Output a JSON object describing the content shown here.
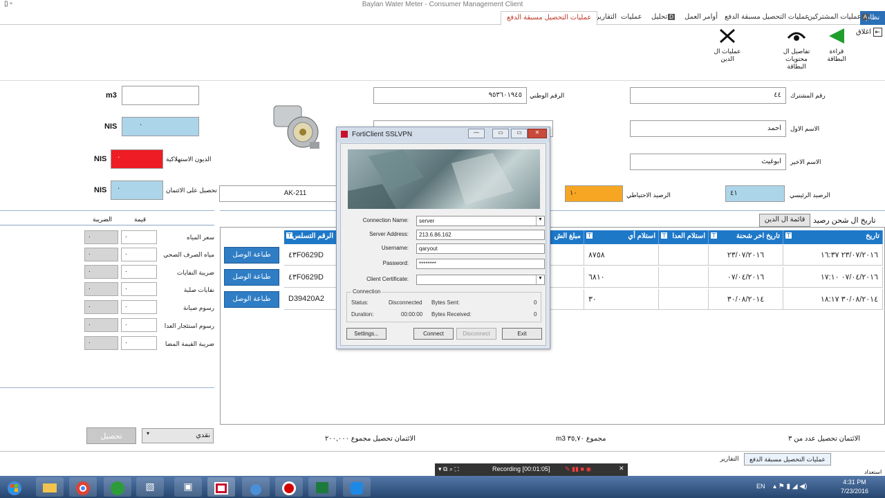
{
  "app": {
    "window_title": "Baylan Water Meter - Consumer Management Client"
  },
  "ribbon": {
    "tabs": [
      {
        "label": "نظام",
        "keytip": ""
      },
      {
        "label": "عمليات المشتركين",
        "keytip": "A"
      },
      {
        "label": "عمليات التحصيل مسبقة الدفع",
        "keytip": ""
      },
      {
        "label": "أوامر العمل",
        "keytip": ""
      },
      {
        "label": "تحليل",
        "keytip": "D"
      },
      {
        "label": "عمليات",
        "keytip": ""
      },
      {
        "label": "التقارير",
        "keytip": "R"
      },
      {
        "label": "عمليات التحصيل مسبقة الدفع",
        "keytip": ""
      }
    ],
    "close_label": "اغلاق",
    "buttons": [
      {
        "label": "قراءة البطاقة",
        "icon": "green-arrow-left-icon"
      },
      {
        "label": "تفاصيل ال محتويات البطاقة",
        "icon": "card-eye-icon"
      },
      {
        "label": "عمليات ال الدين",
        "icon": "debt-ops-icon"
      }
    ]
  },
  "form": {
    "subscriber_no_label": "رقم المشترك",
    "subscriber_no": "٤٤",
    "national_id_label": "الرقم الوطني",
    "national_id": "٩٥٣٦٠١٩٤٥",
    "first_name_label": "الاسم الاول",
    "first_name": "احمد",
    "last_name_label": "الاسم الاخير",
    "last_name": "ابوغيث",
    "main_balance_label": "الرصيد الرئيسي",
    "main_balance": "٤١",
    "reserve_balance_label": "الرصيد الاحتياطي",
    "reserve_balance": "١٠",
    "meter_code": "AK-211",
    "unit_m3": "m3",
    "unit_nis": "NIS",
    "consumption_debt_label": "الديون الاستهلاكية",
    "credit_collection_label": "تحصيل على الائتمان",
    "nis_value_1": "٠",
    "nis_value_2": "٠",
    "nis_value_3": "٠",
    "meter_image_label": "water-meter-image"
  },
  "charges": {
    "header_value": "قيمة",
    "header_tax": "الضريبة",
    "items": [
      {
        "label": "سعر المياه",
        "value": "٠",
        "tax": "٠"
      },
      {
        "label": "مياه الصرف الصحي",
        "value": "٠",
        "tax": "٠"
      },
      {
        "label": "ضريبة النفايات",
        "value": "٠",
        "tax": "٠"
      },
      {
        "label": "نفايات صلبة",
        "value": "٠",
        "tax": "٠"
      },
      {
        "label": "رسوم صيانة",
        "value": "٠",
        "tax": "٠"
      },
      {
        "label": "رسوم استئجار العدا",
        "value": "٠",
        "tax": "٠"
      },
      {
        "label": "ضريبة القيمة المضا",
        "value": "٠",
        "tax": "٠"
      }
    ],
    "payment_method": "نقدي",
    "collect_button": "تحصيل"
  },
  "history": {
    "title": "تاريخ ال شحن رصيد",
    "debt_list_button": "قائمة ال الدين",
    "columns": [
      "تاريخ",
      "تاريخ اخر شحنة",
      "استلام العدا",
      "استلام أي",
      "مبلغ الش",
      "الرقم التسلس"
    ],
    "rows": [
      {
        "date": "٢٣/٠٧/٢٠١٦ ١٦:٣٧",
        "last_charge": "٢٣/٠٧/٢٠١٦",
        "meter_receipt": "",
        "receipt": "٨٧٥٨",
        "amount": "",
        "serial": "٤٣F0629D",
        "print": "طباعة الوصل"
      },
      {
        "date": "٠٧/٠٤/٢٠١٦ ١٧:١٠",
        "last_charge": "٠٧/٠٤/٢٠١٦",
        "meter_receipt": "",
        "receipt": "٦٨١٠",
        "amount": "",
        "serial": "٤٣F0629D",
        "print": "طباعة الوصل"
      },
      {
        "date": "٣٠/٠٨/٢٠١٤ ١٨:١٧",
        "last_charge": "٣٠/٠٨/٢٠١٤",
        "meter_receipt": "",
        "receipt": "٣٠",
        "amount": "",
        "serial": "D39420A2",
        "print": "طباعة الوصل"
      }
    ],
    "footer_count": "الائتمان تحصيل عدد من  ٣",
    "footer_m3": "m3 مجموع  ٣٥,٧٠",
    "footer_total": "الائتمان تحصيل مجموع  ٢٠٠,٠٠٠"
  },
  "bottom_tabs": [
    "عمليات التحصيل مسبقة الدفع",
    "التقارير"
  ],
  "status_text": "استعداد",
  "dialog": {
    "title": "FortiClient SSLVPN",
    "connection_name_label": "Connection Name:",
    "connection_name": "server",
    "server_address_label": "Server Address:",
    "server_address": "213.6.86.162",
    "username_label": "Username:",
    "username": "qaryout",
    "password_label": "Password:",
    "password": "********",
    "client_cert_label": "Client Certificate:",
    "client_cert": "",
    "connection_group": "Connection",
    "status_label": "Status:",
    "status_value": "Disconnected",
    "bytes_sent_label": "Bytes Sent:",
    "bytes_sent": "0",
    "duration_label": "Duration:",
    "duration": "00:00:00",
    "bytes_received_label": "Bytes Received:",
    "bytes_received": "0",
    "btn_settings": "Settings...",
    "btn_connect": "Connect",
    "btn_disconnect": "Disconnect",
    "btn_exit": "Exit"
  },
  "recorder": {
    "label": "Recording [00:01:05]"
  },
  "taskbar": {
    "lang": "EN",
    "time": "4:31 PM",
    "date": "7/23/2016"
  }
}
